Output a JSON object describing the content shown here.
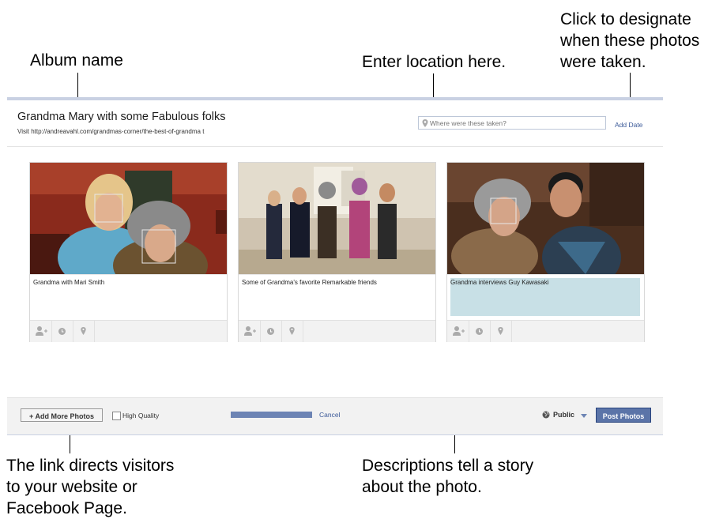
{
  "annotations": {
    "album_name": "Album name",
    "enter_location": "Enter location here.",
    "designate_line1": "Click to designate",
    "designate_line2": "when these photos",
    "designate_line3": "were taken.",
    "link_line1": "The link directs visitors",
    "link_line2": "to your website or",
    "link_line3": "Facebook Page.",
    "desc_line1": "Descriptions tell a story",
    "desc_line2": "about the photo."
  },
  "album": {
    "title": "Grandma Mary with some Fabulous folks",
    "description": "Visit http://andreavahl.com/grandmas-corner/the-best-of-grandma t",
    "location_placeholder": "Where were these taken?",
    "add_date_label": "Add Date"
  },
  "photos": [
    {
      "caption": "Grandma with Mari Smith",
      "icon_tag": "tag-person-icon",
      "icon_date": "clock-icon",
      "icon_location": "location-pin-icon"
    },
    {
      "caption": "Some of Grandma's favorite Remarkable friends",
      "icon_tag": "tag-person-icon",
      "icon_date": "clock-icon",
      "icon_location": "location-pin-icon"
    },
    {
      "caption": "Grandma interviews Guy Kawasaki",
      "icon_tag": "tag-person-icon",
      "icon_date": "clock-icon",
      "icon_location": "location-pin-icon"
    }
  ],
  "footer": {
    "add_more_label": "+ Add More Photos",
    "high_quality_label": "High Quality",
    "upload_progress": 1.0,
    "cancel_label": "Cancel",
    "privacy_label": "Public",
    "post_label": "Post Photos"
  },
  "colors": {
    "link": "#3b5998",
    "post_button": "#5b74a8",
    "progress": "#6d84b4",
    "caption_highlight": "#c8e0e6"
  }
}
